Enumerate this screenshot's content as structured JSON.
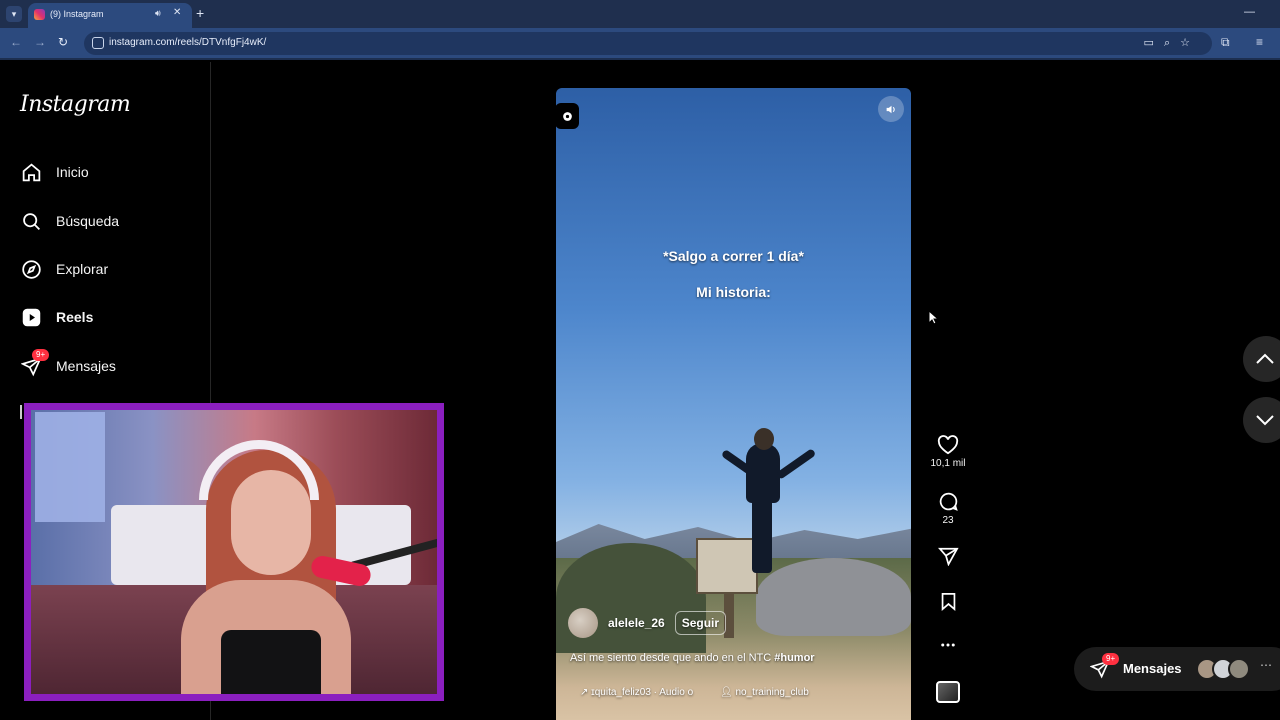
{
  "browser": {
    "tab_title": "(9) Instagram",
    "url": "instagram.com/reels/DTVnfgFj4wK/",
    "new_tab": "+",
    "close": "✕"
  },
  "sidebar": {
    "logo": "Instagram",
    "items": [
      {
        "label": "Inicio",
        "icon": "home-icon"
      },
      {
        "label": "Búsqueda",
        "icon": "search-icon"
      },
      {
        "label": "Explorar",
        "icon": "compass-icon"
      },
      {
        "label": "Reels",
        "icon": "reels-icon"
      },
      {
        "label": "Mensajes",
        "icon": "messages-icon",
        "badge": "9+"
      }
    ]
  },
  "reel": {
    "caption_line1": "*Salgo a correr 1 día*",
    "caption_line2": "Mi historia:",
    "author": "alelele_26",
    "follow": "Seguir",
    "description": "Así me siento desde que ando en el NTC",
    "hashtag": "#humor",
    "audio": "ɪquita_feliz03 · Audio o",
    "tagged": "no_training_club"
  },
  "actions": {
    "likes": "10,1 mil",
    "comments": "23"
  },
  "messages_pill": {
    "label": "Mensajes",
    "badge": "9+"
  },
  "colors": {
    "accent": "#ff3040",
    "webcam_border": "#8b1fbf",
    "chrome": "#2c4a7e"
  }
}
